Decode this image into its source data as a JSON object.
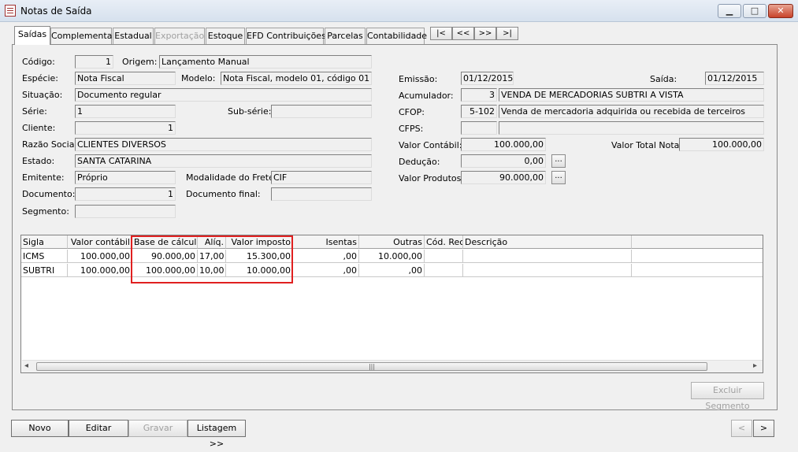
{
  "window": {
    "title": "Notas de Saída",
    "minimize": "▁",
    "maximize": "□",
    "close": "✕"
  },
  "tabs": [
    "Saídas",
    "Complementar",
    "Estadual",
    "Exportação",
    "Estoque",
    "EFD Contribuições",
    "Parcelas",
    "Contabilidade"
  ],
  "nav": [
    "|<",
    "<<",
    ">>",
    ">|"
  ],
  "form": {
    "codigo": {
      "label": "Código:",
      "value": "1"
    },
    "origem": {
      "label": "Origem:",
      "value": "Lançamento Manual"
    },
    "especie": {
      "label": "Espécie:",
      "value": "Nota Fiscal"
    },
    "modelo": {
      "label": "Modelo:",
      "value": "Nota Fiscal, modelo 01, código 01"
    },
    "situacao": {
      "label": "Situação:",
      "value": "Documento regular"
    },
    "serie": {
      "label": "Série:",
      "value": "1"
    },
    "subserie": {
      "label": "Sub-série:",
      "value": ""
    },
    "cliente": {
      "label": "Cliente:",
      "value": "1"
    },
    "razao": {
      "label": "Razão Social:",
      "value": "CLIENTES DIVERSOS"
    },
    "estado": {
      "label": "Estado:",
      "value": "SANTA CATARINA"
    },
    "emitente": {
      "label": "Emitente:",
      "value": "Próprio"
    },
    "frete": {
      "label": "Modalidade do Frete:",
      "value": "CIF"
    },
    "documento": {
      "label": "Documento:",
      "value": "1"
    },
    "docfinal": {
      "label": "Documento final:",
      "value": ""
    },
    "segmento": {
      "label": "Segmento:",
      "value": ""
    },
    "emissao": {
      "label": "Emissão:",
      "value": "01/12/2015"
    },
    "saida": {
      "label": "Saída:",
      "value": "01/12/2015"
    },
    "acumulador": {
      "label": "Acumulador:",
      "code": "3",
      "desc": "VENDA DE MERCADORIAS SUBTRI  A VISTA"
    },
    "cfop": {
      "label": "CFOP:",
      "code": "5-102",
      "desc": "Venda de mercadoria adquirida ou recebida de terceiros"
    },
    "cfps": {
      "label": "CFPS:",
      "code": "",
      "desc": ""
    },
    "valorcontabil": {
      "label": "Valor Contábil:",
      "value": "100.000,00"
    },
    "valortotal": {
      "label": "Valor Total Nota:",
      "value": "100.000,00"
    },
    "deducao": {
      "label": "Dedução:",
      "value": "0,00"
    },
    "valorprodutos": {
      "label": "Valor Produtos:",
      "value": "90.000,00"
    },
    "dots": "..."
  },
  "grid": {
    "headers": [
      "Sigla",
      "Valor contábil",
      "Base de cálculo",
      "Alíq.",
      "Valor imposto",
      "Isentas",
      "Outras",
      "Cód. Rec.",
      "Descrição"
    ],
    "rows": [
      [
        "ICMS",
        "100.000,00",
        "90.000,00",
        "17,00",
        "15.300,00",
        ",00",
        "10.000,00",
        "",
        ""
      ],
      [
        "SUBTRI",
        "100.000,00",
        "100.000,00",
        "10,00",
        "10.000,00",
        ",00",
        ",00",
        "",
        ""
      ]
    ],
    "scroll_left": "◂",
    "scroll_right": "▸",
    "scroll_grip": "|||"
  },
  "buttons": {
    "excluir": "Excluir Segmento",
    "novo": "Novo",
    "editar": "Editar",
    "gravar": "Gravar",
    "listagem": "Listagem >>",
    "prev": "<",
    "next": ">"
  }
}
